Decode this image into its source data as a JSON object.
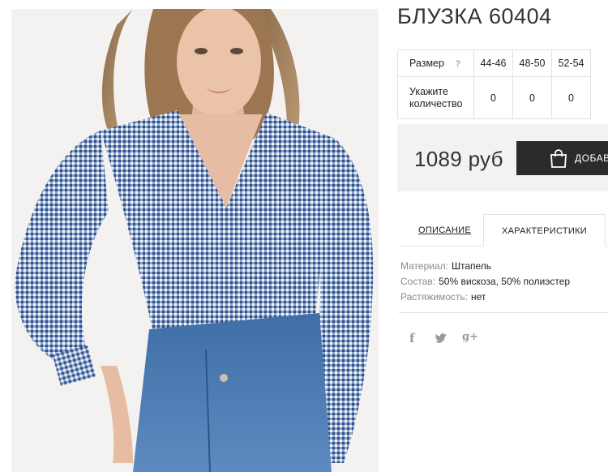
{
  "product": {
    "title": "БЛУЗКА 60404",
    "photo_alt": "модель в блузке в клетку и джинсах"
  },
  "size_table": {
    "header_label": "Размер",
    "help_symbol": "?",
    "sizes": [
      "44-46",
      "48-50",
      "52-54"
    ],
    "qty_label_line1": "Укажите",
    "qty_label_line2": "количество",
    "quantities": [
      "0",
      "0",
      "0"
    ]
  },
  "purchase": {
    "price": "1089 руб",
    "add_button_label": "ДОБАВ",
    "button_icon": "shopping-bag-icon"
  },
  "tabs": {
    "description": "ОПИСАНИЕ",
    "characteristics": "ХАРАКТЕРИСТИКИ",
    "active": "characteristics"
  },
  "specs": [
    {
      "key": "Материал:",
      "value": "Штапель"
    },
    {
      "key": "Состав:",
      "value": "50% вискоза, 50% полиэстер"
    },
    {
      "key": "Растяжимость:",
      "value": "нет"
    }
  ],
  "social": {
    "facebook": "f",
    "twitter": "🐦",
    "googleplus": "g+"
  },
  "colors": {
    "button_bg": "#2b2b2b",
    "price_bg": "#f2f2f2",
    "blouse_blue": "#4a6fa8",
    "jeans_blue": "#3f6fa8"
  }
}
